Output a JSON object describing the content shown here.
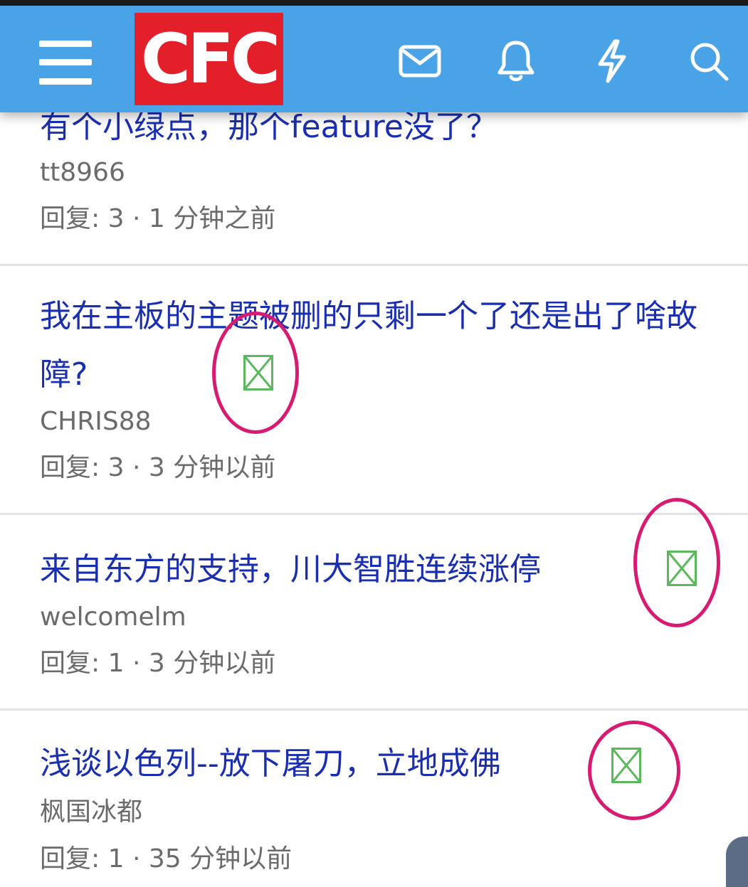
{
  "header": {
    "logo_text": "CFC",
    "icons": [
      "menu-icon",
      "mail-icon",
      "bell-icon",
      "lightning-icon",
      "search-icon"
    ],
    "colors": {
      "bar": "#4aa3e6",
      "logo": "#e3202a"
    }
  },
  "topics": [
    {
      "title": "有个小绿点，那个feature没了？",
      "author": "tt8966",
      "reply_label": "回复:",
      "replies": "3",
      "time": "1 分钟之前"
    },
    {
      "title": "我在主板的主题被删的只剩一个了还是出了啥故障?",
      "author": "CHRIS88",
      "reply_label": "回复:",
      "replies": "3",
      "time": "3 分钟以前",
      "has_image_icon": true
    },
    {
      "title": "来自东方的支持，川大智胜连续涨停",
      "author": "welcomelm",
      "reply_label": "回复:",
      "replies": "1",
      "time": "3 分钟以前",
      "has_image_icon": true
    },
    {
      "title": "浅谈以色列--放下屠刀，立地成佛",
      "author": "枫国冰都",
      "reply_label": "回复:",
      "replies": "1",
      "time": "35 分钟以前",
      "has_image_icon": true
    }
  ],
  "annotation_color": "#d81b72"
}
